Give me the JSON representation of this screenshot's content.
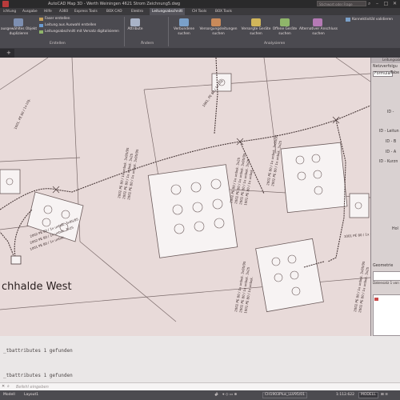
{
  "titlebar": {
    "title": "AutoCAD Map 3D - Werth Weiningen 4621 Strom   Zeichnung5.dwg",
    "search_placeholder": "Stichwort oder Frage eingeben",
    "minimize": "–",
    "maximize": "□",
    "close": "✕"
  },
  "tabs": [
    "ichtung",
    "Ausgabe",
    "Hilfe",
    "A360",
    "Express Tools",
    "BOX CAD",
    "Elektro",
    "Leitungsabschnitt",
    "CH Tools",
    "BOX Tools"
  ],
  "active_tab": "Leitungsabschnitt",
  "ribbon": {
    "create_big_button_line1": "ausgewähltes Objekt",
    "create_big_button_line2": "duplizieren",
    "create_items": [
      "Faser erstellen",
      "Leitung aus Auswahl erstellen",
      "Leitungsabschnitt mit Versatz digitalisieren"
    ],
    "create_panel": "Erstellen",
    "change_button": "Attribute",
    "change_panel": "Ändern",
    "analysis_buttons": [
      {
        "line1": "Verbundene",
        "line2": "suchen"
      },
      {
        "line1": "Versorgungsleitungen",
        "line2": "suchen"
      },
      {
        "line1": "Versorgte Geräte",
        "line2": "suchen"
      },
      {
        "line1": "Offene Geräte",
        "line2": "suchen"
      },
      {
        "line1": "Alternativer Anschluss",
        "line2": "suchen"
      }
    ],
    "analysis_panel": "Analysieren",
    "validate_button": "Konnektivität validieren"
  },
  "drawing": {
    "location_label": "chhalde West",
    "segment_label": "1001, PE 80 / 1x Ltg.",
    "cable_label_a": "2002 PE 80 / 1x unbek. 3x95/95",
    "cable_label_b": "2002 PE 80 / 1x unbek. 3x25",
    "cable_label_c": "1001 PE 80 / 1x unbek."
  },
  "palette": {
    "header": "Leitungsab",
    "title": "Netzverfolgu",
    "tab1": "Formular",
    "tab2": "Tabe",
    "field1": "ID -",
    "field2": "ID - Leitun",
    "field3": "ID - B",
    "field4": "ID - A",
    "field5": "ID - Kurzn",
    "field6": "Hol",
    "geometry": "Geometrie",
    "record": "Datensatz 1 von"
  },
  "command": {
    "line1": "_tbattributes 1 gefunden",
    "line2": "_tbattributes 1 gefunden",
    "input_placeholder": "Befehl eingeben"
  },
  "status": {
    "model": "MODELL",
    "layout": "CH1903Plus_LLV95/01",
    "scale": "1:112.622",
    "grid": "#",
    "tabs": [
      "Modell",
      "Layout1"
    ]
  }
}
